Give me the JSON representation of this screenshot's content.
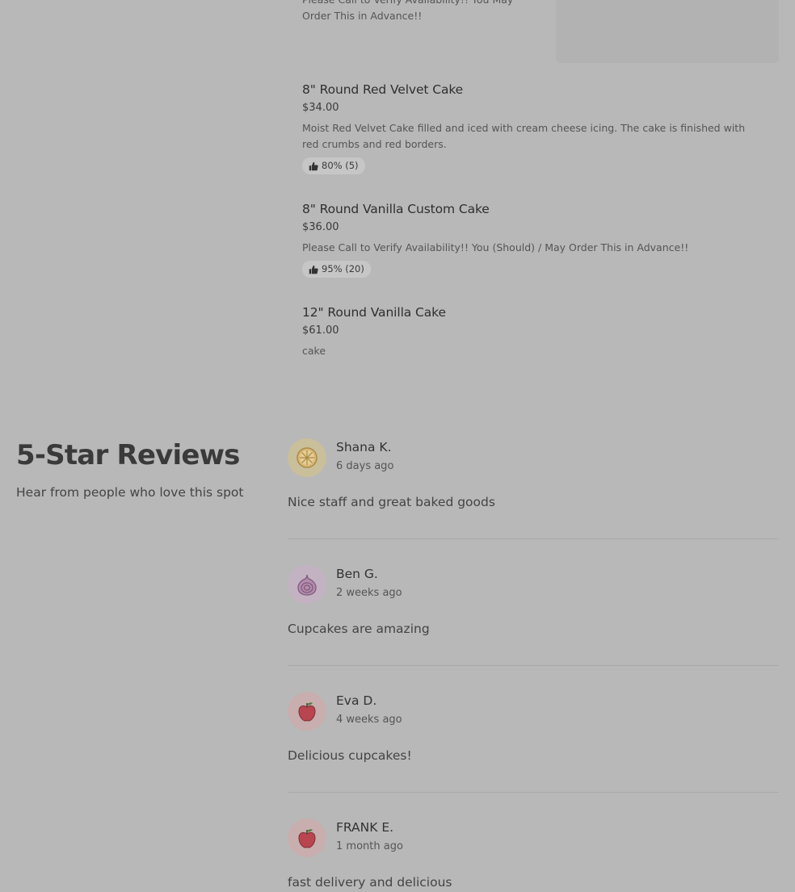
{
  "menu": {
    "top_partial_desc": "Please Call to Verify Availability!! You May Order This in Advance!!",
    "items": [
      {
        "name": "8\" Round Red Velvet Cake",
        "price": "$34.00",
        "description": "Moist Red Velvet Cake filled and iced with cream cheese icing. The cake is finished with red crumbs and red borders.",
        "rating": "80% (5)"
      },
      {
        "name": "8\" Round Vanilla Custom Cake",
        "price": "$36.00",
        "description": "Please Call to Verify Availability!! You (Should) / May Order This in Advance!!",
        "rating": "95% (20)"
      },
      {
        "name": "12\" Round Vanilla Cake",
        "price": "$61.00",
        "description": "cake"
      }
    ]
  },
  "reviews_section": {
    "title": "5-Star Reviews",
    "subtitle": "Hear from people who love this spot",
    "reviews": [
      {
        "name": "Shana K.",
        "time": "6 days ago",
        "text": "Nice staff and great baked goods",
        "avatar_icon": "orange-slice-icon"
      },
      {
        "name": "Ben G.",
        "time": "2 weeks ago",
        "text": "Cupcakes are amazing",
        "avatar_icon": "onion-icon"
      },
      {
        "name": "Eva D.",
        "time": "4 weeks ago",
        "text": "Delicious cupcakes!",
        "avatar_icon": "apple-icon"
      },
      {
        "name": "FRANK E.",
        "time": "1 month ago",
        "text": "fast delivery and delicious",
        "avatar_icon": "apple-icon"
      }
    ]
  },
  "colors": {
    "overlay_bg": "#b8b8b8",
    "avatar_orange": "#c9bf9a",
    "avatar_onion": "#c2b2c2",
    "avatar_apple": "#c8aeae"
  }
}
